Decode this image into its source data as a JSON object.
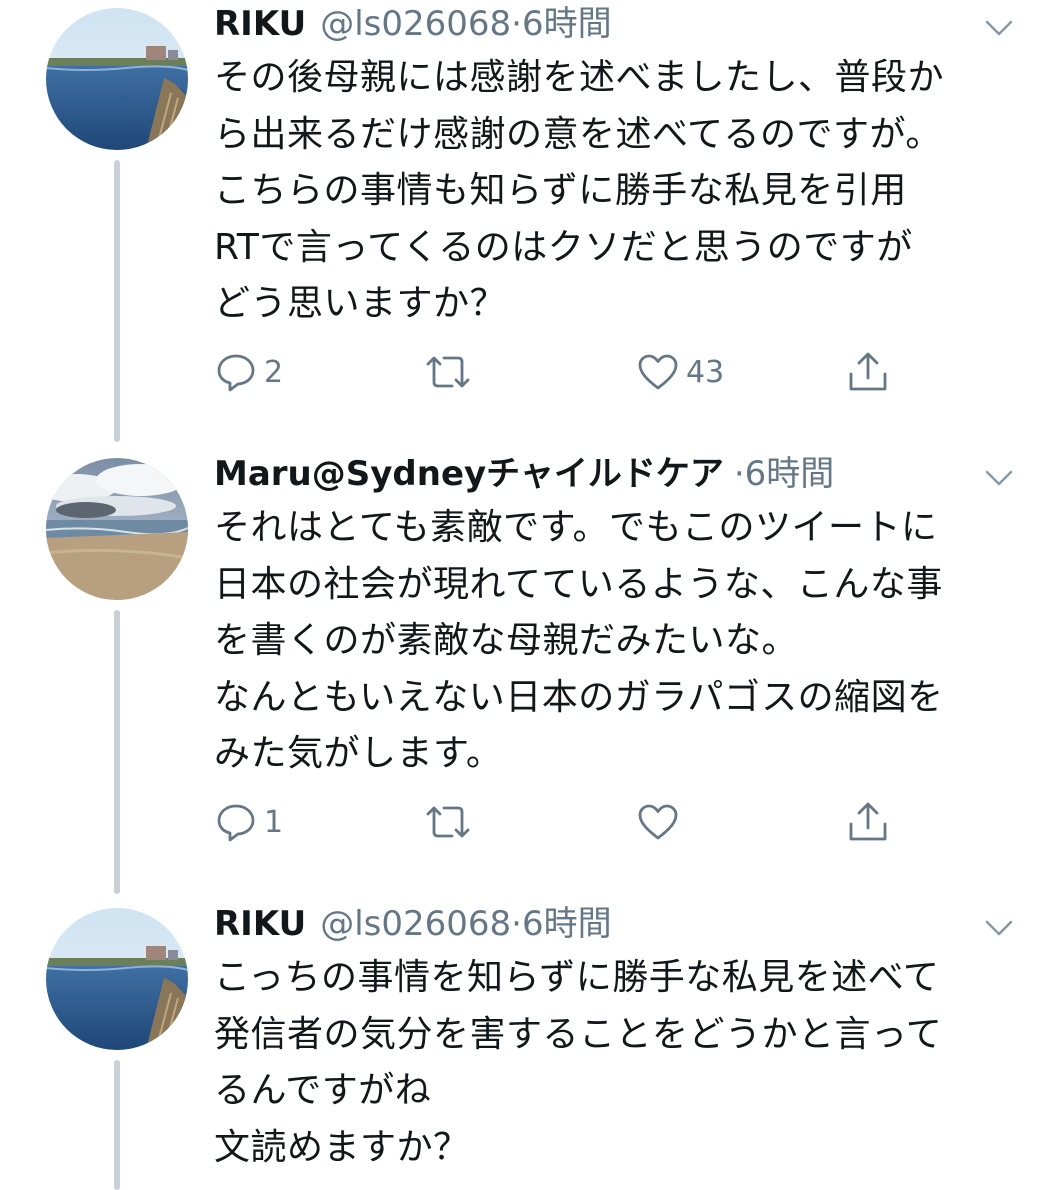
{
  "tweets": [
    {
      "name": "RIKU",
      "handle": "@ls026068",
      "sep": "·",
      "time": "6時間",
      "text": "その後母親には感謝を述べましたし、普段か\nら出来るだけ感謝の意を述べてるのですが。\nこちらの事情も知らずに勝手な私見を引用\nRTで言ってくるのはクソだと思うのですが\nどう思いますか？",
      "reply_count": "2",
      "like_count": "43",
      "avatar": "lake-photo"
    },
    {
      "name": "Maru@Sydneyチャイルドケア",
      "handle": "",
      "sep": "·",
      "time": "6時間",
      "text": "それはとても素敵です。でもこのツイートに\n日本の社会が現れてているような、こんな事\nを書くのが素敵な母親だみたいな。\nなんともいえない日本のガラパゴスの縮図を\nみた気がします。",
      "reply_count": "1",
      "like_count": "",
      "avatar": "beach-photo"
    },
    {
      "name": "RIKU",
      "handle": "@ls026068",
      "sep": "·",
      "time": "6時間",
      "text": "こっちの事情を知らずに勝手な私見を述べて\n発信者の気分を害することをどうかと言って\nるんですがね\n文読めますか？",
      "avatar": "lake-photo"
    }
  ],
  "icons": [
    "reply-icon",
    "retweet-icon",
    "like-icon",
    "share-icon",
    "caret-down-icon"
  ],
  "colors": {
    "text": "#14171a",
    "secondary": "#657786",
    "thread_line": "#c8d0d8"
  }
}
